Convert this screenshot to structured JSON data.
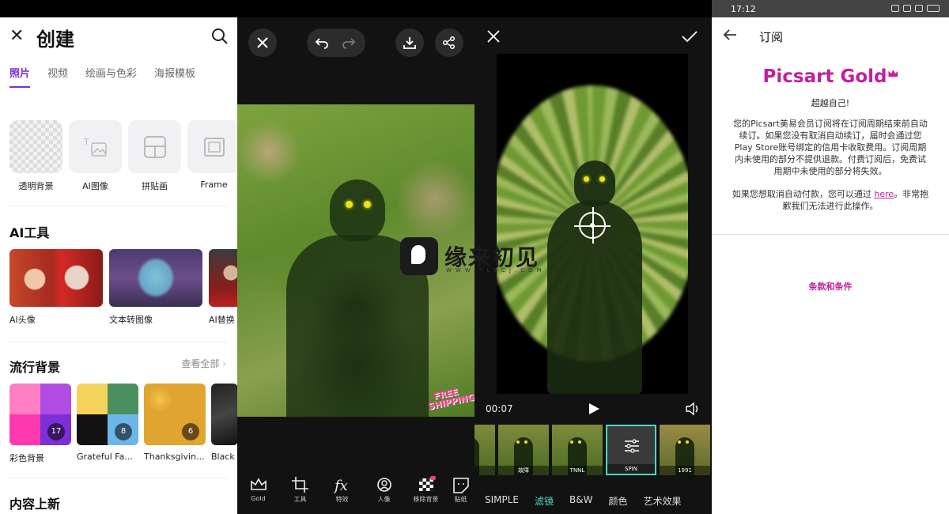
{
  "panel1": {
    "title": "创建",
    "tabs": [
      "照片",
      "视频",
      "绘画与色彩",
      "海报模板"
    ],
    "quick_tiles": [
      {
        "label": "透明背景",
        "icon": "transparent-icon"
      },
      {
        "label": "AI图像",
        "icon": "ai-image-icon"
      },
      {
        "label": "拼贴画",
        "icon": "collage-icon"
      },
      {
        "label": "Frame",
        "icon": "frame-icon"
      }
    ],
    "ai_tools_title": "AI工具",
    "ai_tools": [
      {
        "label": "AI头像"
      },
      {
        "label": "文本转图像"
      },
      {
        "label": "AI替换"
      }
    ],
    "trending_title": "流行背景",
    "see_all": "查看全部",
    "backgrounds": [
      {
        "label": "彩色背景",
        "count": "17"
      },
      {
        "label": "Grateful Fa...",
        "count": "8"
      },
      {
        "label": "Thanksgivin...",
        "count": "6"
      },
      {
        "label": "Black"
      }
    ],
    "new_content_title": "内容上新"
  },
  "panel2": {
    "badge": "FREE SHIPPING",
    "tools": [
      {
        "label": "Gold",
        "icon": "crown-icon"
      },
      {
        "label": "工具",
        "icon": "crop-icon"
      },
      {
        "label": "特效",
        "icon": "fx-icon"
      },
      {
        "label": "人像",
        "icon": "portrait-icon"
      },
      {
        "label": "移除背景",
        "icon": "remove-bg-icon"
      },
      {
        "label": "贴纸",
        "icon": "sticker-icon"
      }
    ]
  },
  "panel3": {
    "time": "00:07",
    "thumbnails": [
      {
        "label": ""
      },
      {
        "label": "故障"
      },
      {
        "label": "TNNL"
      },
      {
        "label": "SPIN",
        "selected": true
      },
      {
        "label": "1991"
      }
    ],
    "filter_tabs": [
      "SIMPLE",
      "滤镜",
      "B&W",
      "颜色",
      "艺术效果"
    ],
    "active_filter_tab": "滤镜"
  },
  "panel4": {
    "status_time": "17:12",
    "title": "订阅",
    "logo_text": "Picsart Gold",
    "tagline": "超越自己!",
    "body": "您的Picsart美易会员订阅将在订阅周期结束前自动续订。如果您没有取消自动续订，届时会通过您Play Store账号绑定的信用卡收取费用。订阅周期内未使用的部分不提供退款。付费订阅后，免费试用期中未使用的部分将失效。",
    "cancel_text_before": "如果您想取消自动付款，您可以通过 ",
    "cancel_link": "here",
    "cancel_text_after": "。非常抱歉我们无法进行此操作。",
    "terms": "条款和条件",
    "accent": "#c21f9d"
  },
  "watermark": {
    "text": "缘来初见",
    "url": "WWW.YLBCJ.COM"
  }
}
